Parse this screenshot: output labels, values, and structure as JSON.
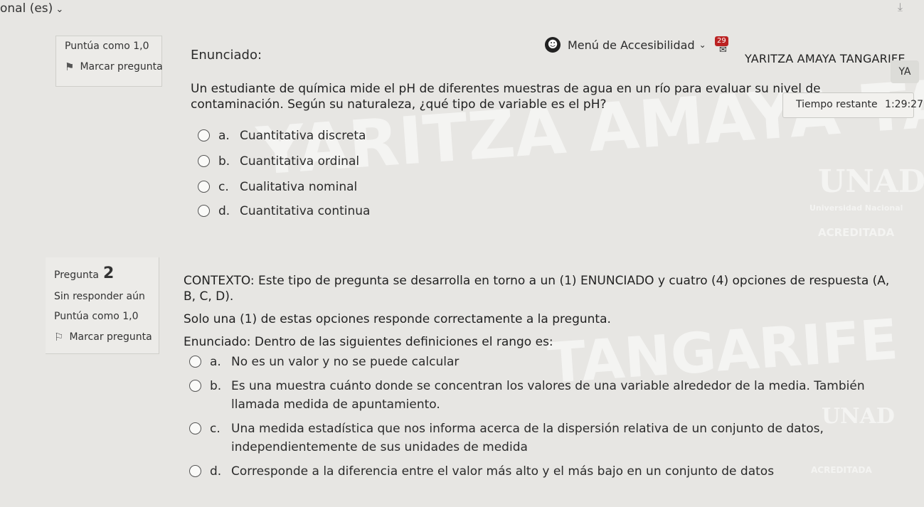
{
  "topbar": {
    "language": "onal (es)"
  },
  "header": {
    "accessibility_menu": "Menú de Accesibilidad",
    "notification_count": "29",
    "user_name": "YARITZA AMAYA TANGARIFE",
    "user_initials": "YA"
  },
  "timer": {
    "label": "Tiempo restante",
    "value": "1:29:27"
  },
  "question1": {
    "score": "Puntúa como 1,0",
    "flag_label": "Marcar pregunta",
    "statement_label": "Enunciado:",
    "text": "Un estudiante de química mide el pH de diferentes muestras de agua en un río para evaluar su nivel de contaminación. Según su naturaleza, ¿qué tipo de variable es el pH?",
    "options": [
      {
        "letter": "a.",
        "text": "Cuantitativa discreta"
      },
      {
        "letter": "b.",
        "text": "Cuantitativa ordinal"
      },
      {
        "letter": "c.",
        "text": "Cualitativa nominal"
      },
      {
        "letter": "d.",
        "text": "Cuantitativa continua"
      }
    ]
  },
  "question2": {
    "label": "Pregunta",
    "number": "2",
    "status": "Sin responder aún",
    "score": "Puntúa como 1,0",
    "flag_label": "Marcar pregunta",
    "context_1": "CONTEXTO: Este tipo de pregunta se desarrolla en torno a un (1) ENUNCIADO y cuatro (4) opciones de respuesta (A, B, C, D).",
    "context_2": "Solo una (1) de estas opciones responde correctamente a la pregunta.",
    "statement": "Enunciado: Dentro de las siguientes definiciones el rango es:",
    "options": [
      {
        "letter": "a.",
        "text": "No es un valor y no se puede calcular"
      },
      {
        "letter": "b.",
        "text": "Es una muestra cuánto donde se concentran los valores de una variable alrededor de la media. También llamada medida de apuntamiento."
      },
      {
        "letter": "c.",
        "text": "Una medida estadística que nos informa acerca de la dispersión relativa de un conjunto de datos, independientemente de sus unidades de medida"
      },
      {
        "letter": "d.",
        "text": "Corresponde a la diferencia entre el valor más alto y el más bajo en un conjunto de datos"
      }
    ]
  },
  "watermark": {
    "name_1": "YARITZA AMAYA TANGA",
    "name_2": "TANGARIFE",
    "logo_1": "UNAD",
    "caption_1": "Universidad Nacional",
    "badge_1": "ACREDITADA",
    "logo_2": "UNAD",
    "badge_2": "ACREDITADA"
  },
  "icons": [
    "chevron-down-icon",
    "accessibility-icon",
    "envelope-icon",
    "download-icon",
    "flag-icon",
    "radio-icon"
  ]
}
